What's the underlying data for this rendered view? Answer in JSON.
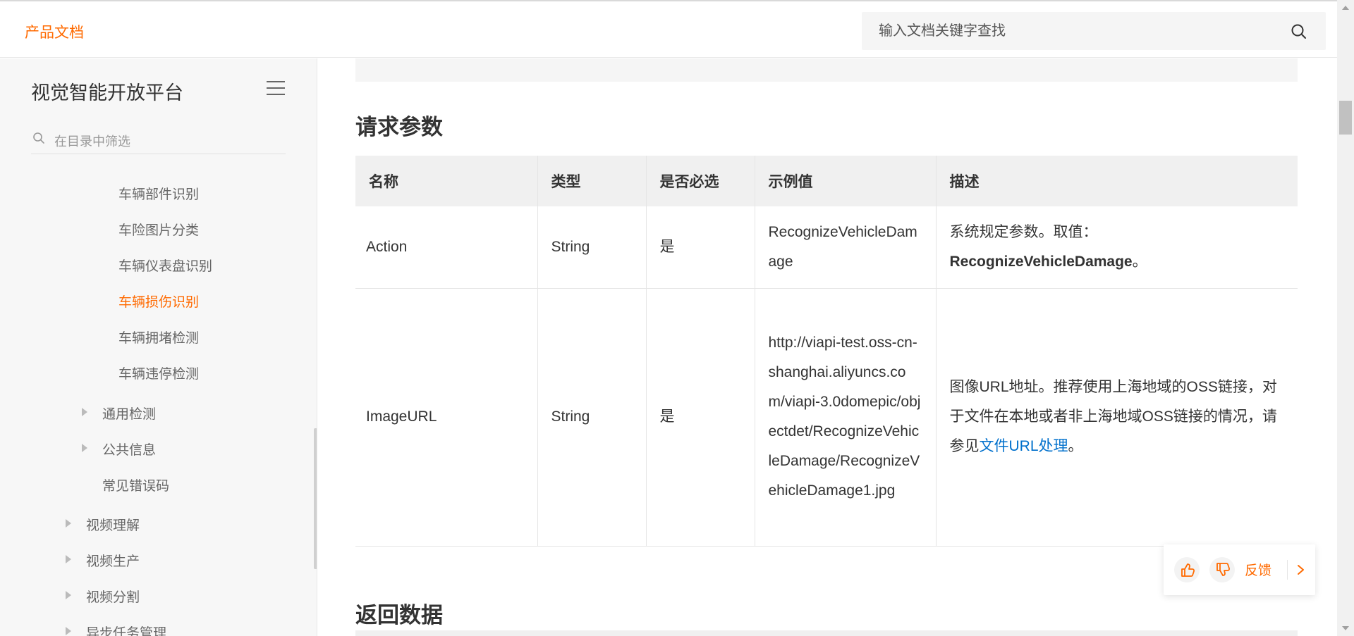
{
  "header": {
    "brand": "产品文档",
    "search_placeholder": "输入文档关键字查找"
  },
  "sidebar": {
    "title": "视觉智能开放平台",
    "filter_placeholder": "在目录中筛选",
    "items": [
      {
        "label": "车辆部件识别"
      },
      {
        "label": "车险图片分类"
      },
      {
        "label": "车辆仪表盘识别"
      },
      {
        "label": "车辆损伤识别",
        "active": true
      },
      {
        "label": "车辆拥堵检测"
      },
      {
        "label": "车辆违停检测"
      },
      {
        "label": "通用检测"
      },
      {
        "label": "公共信息"
      },
      {
        "label": "常见错误码"
      },
      {
        "label": "视频理解"
      },
      {
        "label": "视频生产"
      },
      {
        "label": "视频分割"
      },
      {
        "label": "异步任务管理"
      }
    ]
  },
  "main": {
    "section_request": "请求参数",
    "section_response": "返回数据",
    "table": {
      "headers": [
        "名称",
        "类型",
        "是否必选",
        "示例值",
        "描述"
      ],
      "rows": [
        {
          "name": "Action",
          "type": "String",
          "required": "是",
          "example": "RecognizeVehicleDamage",
          "desc_prefix": "系统规定参数。取值：",
          "desc_bold": "RecognizeVehicleDamage",
          "desc_suffix": "。"
        },
        {
          "name": "ImageURL",
          "type": "String",
          "required": "是",
          "example": "http://viapi-test.oss-cn-shanghai.aliyuncs.com/viapi-3.0domepic/objectdet/RecognizeVehicleDamage/RecognizeVehicleDamage1.jpg",
          "desc_prefix": "图像URL地址。推荐使用上海地域的OSS链接，对于文件在本地或者非上海地域OSS链接的情况，请参见",
          "desc_link": "文件URL处理",
          "desc_suffix": "。"
        }
      ]
    }
  },
  "feedback": {
    "label": "反馈",
    "icons": [
      "thumbs-up-icon",
      "thumbs-down-icon",
      "chevron-right-icon"
    ]
  },
  "colors": {
    "accent": "#ff6a00",
    "link": "#0070cc",
    "sidebar_bg": "#f7f7f7",
    "table_header_bg": "#f0f0f0"
  }
}
